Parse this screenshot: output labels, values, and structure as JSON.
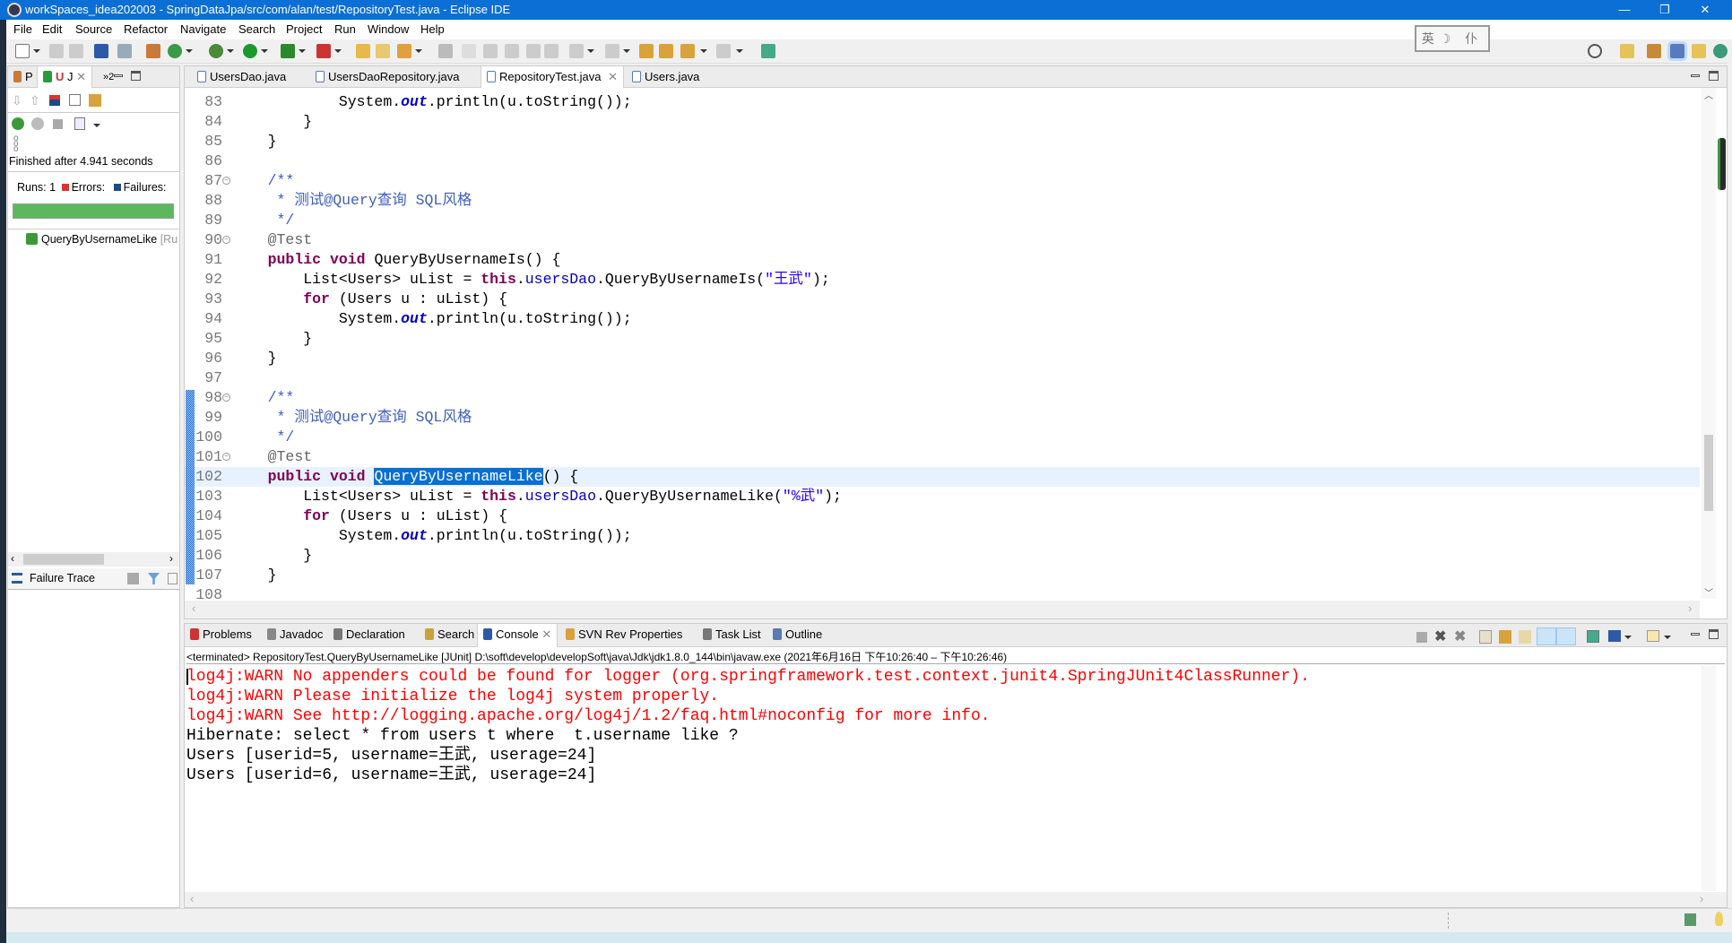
{
  "window": {
    "title": "workSpaces_idea202003 - SpringDataJpa/src/com/alan/test/RepositoryTest.java - Eclipse IDE",
    "minimize": "—",
    "restore": "❐",
    "close": "✕"
  },
  "menu": [
    "File",
    "Edit",
    "Source",
    "Refactor",
    "Navigate",
    "Search",
    "Project",
    "Run",
    "Window",
    "Help"
  ],
  "ime": "英☽ 仆",
  "left_panel": {
    "tabs": [
      "P",
      "J",
      "»2"
    ],
    "status": "Finished after 4.941 seconds",
    "runs_label": "Runs:",
    "runs": "1",
    "errors_label": "Errors:",
    "failures_label": "Failures:",
    "progress_percent": 100,
    "progress_color": "#5cb85c",
    "tree_item": "QueryByUsernameLike",
    "tree_item_suffix": "[Ru",
    "failure_trace": "Failure Trace"
  },
  "editor": {
    "tabs": [
      {
        "label": "UsersDao.java"
      },
      {
        "label": "UsersDaoRepository.java"
      },
      {
        "label": "RepositoryTest.java",
        "active": true
      },
      {
        "label": "Users.java"
      }
    ],
    "current_line": 102,
    "lines": [
      {
        "n": "83",
        "t": [
          [
            "        System."
          ],
          [
            "out",
            "so"
          ],
          [
            ".println(u.toString());"
          ]
        ]
      },
      {
        "n": "84",
        "t": [
          [
            "    }"
          ]
        ]
      },
      {
        "n": "85",
        "t": [
          [
            "}"
          ]
        ]
      },
      {
        "n": "86",
        "t": [
          [
            ""
          ]
        ]
      },
      {
        "n": "87",
        "f": true,
        "t": [
          [
            "/**",
            "cm"
          ]
        ]
      },
      {
        "n": "88",
        "t": [
          [
            " * 测试@Query查询 SQL风格",
            "cm"
          ]
        ]
      },
      {
        "n": "89",
        "t": [
          [
            " */",
            "cm"
          ]
        ]
      },
      {
        "n": "90",
        "f": true,
        "t": [
          [
            "@Test",
            "an"
          ]
        ]
      },
      {
        "n": "91",
        "t": [
          [
            "public",
            "kw"
          ],
          [
            " "
          ],
          [
            "void",
            "kw"
          ],
          [
            " QueryByUsernameIs() {"
          ]
        ]
      },
      {
        "n": "92",
        "t": [
          [
            "    List<Users> uList = "
          ],
          [
            "this",
            "kw"
          ],
          [
            "."
          ],
          [
            "usersDao",
            "fd"
          ],
          [
            ".QueryByUsernameIs("
          ],
          [
            "\"王武\"",
            "st"
          ],
          [
            ");"
          ]
        ]
      },
      {
        "n": "93",
        "t": [
          [
            "    "
          ],
          [
            "for",
            "kw"
          ],
          [
            " (Users u : uList) {"
          ]
        ]
      },
      {
        "n": "94",
        "t": [
          [
            "        System."
          ],
          [
            "out",
            "so"
          ],
          [
            ".println(u.toString());"
          ]
        ]
      },
      {
        "n": "95",
        "t": [
          [
            "    }"
          ]
        ]
      },
      {
        "n": "96",
        "t": [
          [
            "}"
          ]
        ]
      },
      {
        "n": "97",
        "t": [
          [
            ""
          ]
        ]
      },
      {
        "n": "98",
        "f": true,
        "t": [
          [
            "/**",
            "cm"
          ]
        ]
      },
      {
        "n": "99",
        "t": [
          [
            " * 测试@Query查询 SQL风格",
            "cm"
          ]
        ]
      },
      {
        "n": "100",
        "t": [
          [
            " */",
            "cm"
          ]
        ]
      },
      {
        "n": "101",
        "f": true,
        "t": [
          [
            "@Test",
            "an"
          ]
        ]
      },
      {
        "n": "102",
        "t": [
          [
            "public",
            "kw"
          ],
          [
            " "
          ],
          [
            "void",
            "kw"
          ],
          [
            " "
          ],
          [
            "QueryByUsernameLike",
            "sel"
          ],
          [
            "() {"
          ]
        ]
      },
      {
        "n": "103",
        "t": [
          [
            "    List<Users> uList = "
          ],
          [
            "this",
            "kw"
          ],
          [
            "."
          ],
          [
            "usersDao",
            "fd"
          ],
          [
            ".QueryByUsernameLike("
          ],
          [
            "\"%武\"",
            "st"
          ],
          [
            ");"
          ]
        ]
      },
      {
        "n": "104",
        "t": [
          [
            "    "
          ],
          [
            "for",
            "kw"
          ],
          [
            " (Users u : uList) {"
          ]
        ]
      },
      {
        "n": "105",
        "t": [
          [
            "        System."
          ],
          [
            "out",
            "so"
          ],
          [
            ".println(u.toString());"
          ]
        ]
      },
      {
        "n": "106",
        "t": [
          [
            "    }"
          ]
        ]
      },
      {
        "n": "107",
        "t": [
          [
            "}"
          ]
        ]
      },
      {
        "n": "108",
        "t": [
          [
            ""
          ]
        ]
      }
    ]
  },
  "bottom_panel": {
    "tabs": [
      {
        "label": "Problems"
      },
      {
        "label": "Javadoc"
      },
      {
        "label": "Declaration"
      },
      {
        "label": "Search"
      },
      {
        "label": "Console",
        "active": true
      },
      {
        "label": "SVN Rev Properties"
      },
      {
        "label": "Task List"
      },
      {
        "label": "Outline"
      }
    ],
    "terminated": "<terminated> RepositoryTest.QueryByUsernameLike [JUnit] D:\\soft\\develop\\developSoft\\java\\Jdk\\jdk1.8.0_144\\bin\\javaw.exe  (2021年6月16日 下午10:26:40 – 下午10:26:46)",
    "console": [
      {
        "text": "log4j:WARN No appenders could be found for logger (org.springframework.test.context.junit4.SpringJUnit4ClassRunner).",
        "err": true
      },
      {
        "text": "log4j:WARN Please initialize the log4j system properly.",
        "err": true
      },
      {
        "text": "log4j:WARN See http://logging.apache.org/log4j/1.2/faq.html#noconfig for more info.",
        "err": true
      },
      {
        "text": "Hibernate: select * from users t where  t.username like ?"
      },
      {
        "text": "Users [userid=5, username=王武, userage=24]"
      },
      {
        "text": "Users [userid=6, username=王武, userage=24]"
      }
    ]
  }
}
